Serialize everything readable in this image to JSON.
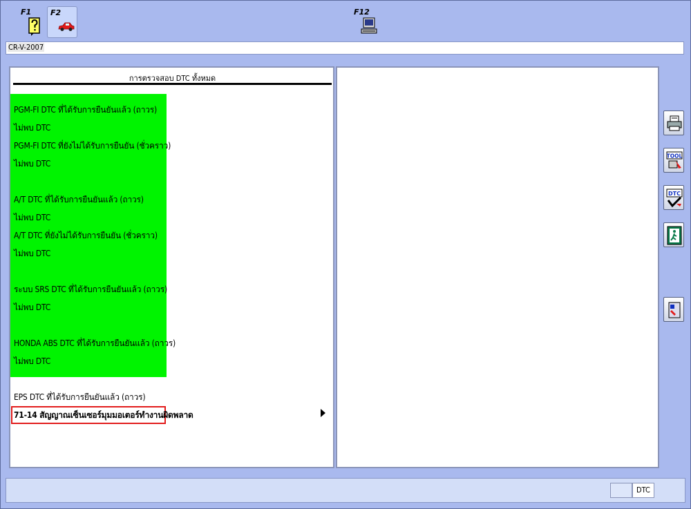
{
  "toolbar": {
    "f1_label": "F1",
    "f2_label": "F2",
    "f12_label": "F12"
  },
  "vehicle": "CR-V-2007",
  "panel_title": "การตรวจสอบ DTC ทั้งหมด",
  "rows": [
    "PGM-FI DTC ที่ได้รับการยืนยันแล้ว (ถาวร)",
    "ไม่พบ DTC",
    "PGM-FI DTC ที่ยังไม่ได้รับการยืนยัน (ชั่วคราว)",
    "ไม่พบ DTC",
    "A/T DTC ที่ได้รับการยืนยันแล้ว (ถาวร)",
    "ไม่พบ DTC",
    "A/T DTC ที่ยังไม่ได้รับการยืนยัน (ชั่วคราว)",
    "ไม่พบ DTC",
    "ระบบ SRS DTC ที่ได้รับการยืนยันแล้ว (ถาวร)",
    "ไม่พบ DTC",
    "HONDA ABS DTC ที่ได้รับการยืนยันแล้ว (ถาวร)",
    "ไม่พบ DTC",
    "EPS DTC ที่ได้รับการยืนยันแล้ว (ถาวร)",
    "71-14 สัญญาณเซ็นเซอร์มุมมอเตอร์ทำงานผิดพลาด"
  ],
  "side_buttons": {
    "tool_label": "TOOL",
    "dtc_label": "DTC"
  },
  "status": {
    "dtc_label": "DTC"
  },
  "colors": {
    "background": "#a9b9ee",
    "ok_green": "#00f400",
    "selection_red": "#e21b1b"
  }
}
